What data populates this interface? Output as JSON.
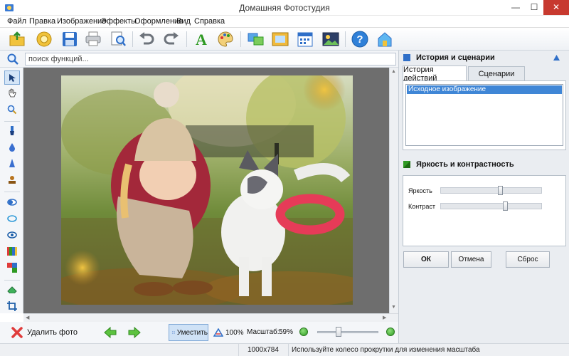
{
  "window": {
    "title": "Домашняя Фотостудия",
    "minimize": "—",
    "maximize": "☐",
    "close": "✕"
  },
  "menu": [
    "Файл",
    "Правка",
    "Изображение",
    "Эффекты",
    "Оформление",
    "Вид",
    "Справка"
  ],
  "search": {
    "placeholder": "поиск функций..."
  },
  "bottom": {
    "delete_label": "Удалить фото",
    "fit_label": "Уместить",
    "zoom100_label": "100%",
    "scale_label": "Масштаб:",
    "scale_value": "59%",
    "scale_fraction": 0.59
  },
  "status": {
    "dimensions": "1000x784",
    "hint": "Используйте колесо прокрутки для изменения масштаба"
  },
  "panel": {
    "history_title": "История и сценарии",
    "tabs": [
      "История действий",
      "Сценарии"
    ],
    "history_items": [
      "Исходное изображение"
    ],
    "bc_title": "Яркость и контрастность",
    "brightness_label": "Яркость",
    "contrast_label": "Контраст",
    "brightness_level": 0.6,
    "contrast_level": 0.65,
    "ok": "ОК",
    "cancel": "Отмена",
    "reset": "Сброс"
  },
  "colors": {
    "accent": "#3f86d6",
    "close": "#c7392f",
    "green": "#2f9a23"
  }
}
